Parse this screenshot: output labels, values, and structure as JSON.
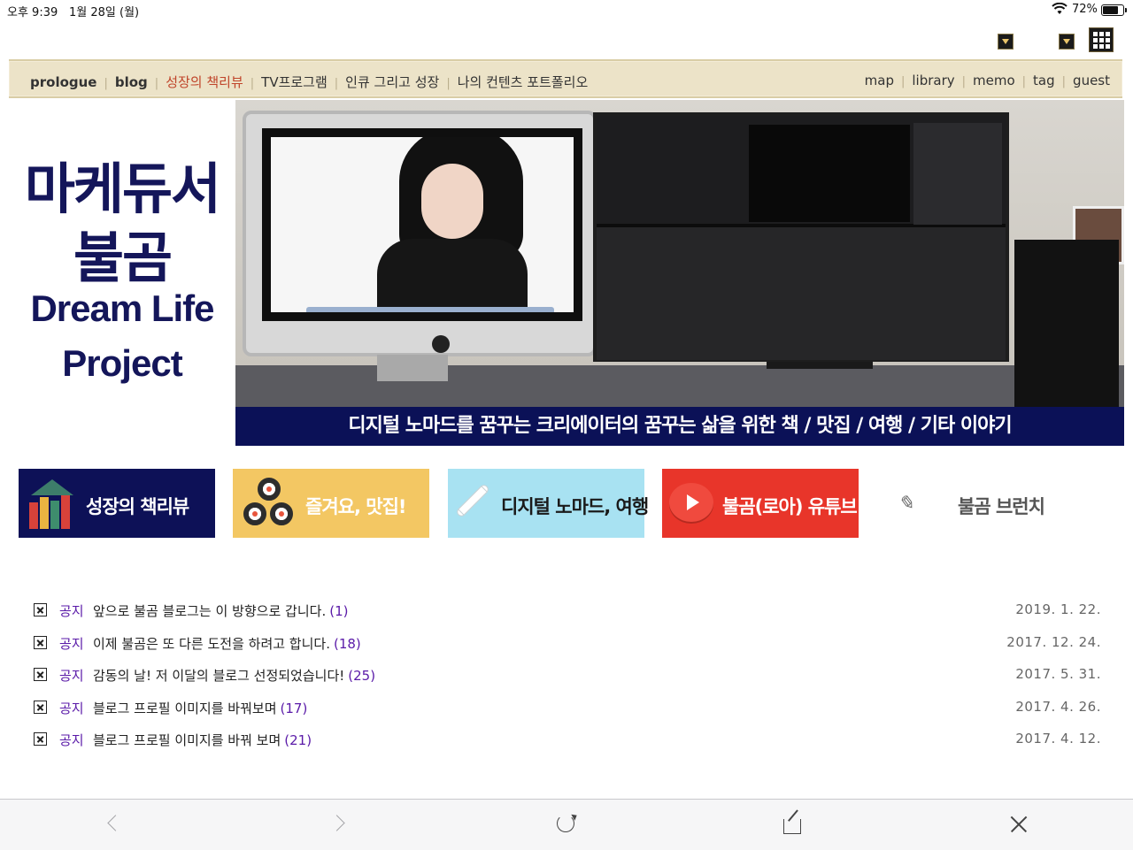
{
  "status_bar": {
    "time": "오후 9:39",
    "date": "1월 28일 (월)",
    "battery_percent": "72%",
    "battery_level": 0.72
  },
  "nav": {
    "left_items": [
      {
        "label": "prologue",
        "style": "bold"
      },
      {
        "label": "blog",
        "style": "bold"
      },
      {
        "label": "성장의 책리뷰",
        "style": "active"
      },
      {
        "label": "TV프로그램",
        "style": "normal"
      },
      {
        "label": "인큐 그리고 성장",
        "style": "normal"
      },
      {
        "label": "나의 컨텐츠 포트폴리오",
        "style": "normal"
      }
    ],
    "right_items": [
      {
        "label": "map"
      },
      {
        "label": "library"
      },
      {
        "label": "memo"
      },
      {
        "label": "tag"
      },
      {
        "label": "guest"
      }
    ]
  },
  "hero": {
    "logo_lines": [
      "마케듀서",
      "불곰",
      "Dream Life",
      "Project"
    ],
    "banner_text": "디지털 노마드를 꿈꾸는 크리에이터의 꿈꾸는 삶을 위한 책 / 맛집 / 여행 / 기타 이야기"
  },
  "categories": [
    {
      "label": "성장의 책리뷰",
      "icon": "bookshelf-icon",
      "bg": "#0d1157"
    },
    {
      "label": "즐겨요, 맛집!",
      "icon": "sushi-icon",
      "bg": "#f3c763"
    },
    {
      "label": "디지털 노마드, 여행",
      "icon": "airplane-icon",
      "bg": "#a8e2f2"
    },
    {
      "label": "불곰(로아) 유튜브",
      "icon": "youtube-play-icon",
      "bg": "#e8352a"
    },
    {
      "label": "불곰 브런치",
      "icon": "brunch-pen-icon",
      "bg": "#ffffff"
    }
  ],
  "notices": [
    {
      "tag": "공지",
      "title": "앞으로 불곰 블로그는 이 방향으로 갑니다.",
      "count": "(1)",
      "date": "2019. 1. 22."
    },
    {
      "tag": "공지",
      "title": "이제 불곰은 또 다른 도전을 하려고 합니다.",
      "count": "(18)",
      "date": "2017. 12. 24."
    },
    {
      "tag": "공지",
      "title": "감동의 날! 저 이달의 블로그 선정되었습니다!",
      "count": "(25)",
      "date": "2017. 5. 31."
    },
    {
      "tag": "공지",
      "title": "블로그 프로필 이미지를 바꿔보며",
      "count": "(17)",
      "date": "2017. 4. 26."
    },
    {
      "tag": "공지",
      "title": "블로그 프로필 이미지를 바꿔 보며",
      "count": "(21)",
      "date": "2017. 4. 12."
    }
  ],
  "toolbar": {
    "icons": [
      "back-icon",
      "forward-icon",
      "reload-icon",
      "share-icon",
      "close-icon"
    ]
  }
}
